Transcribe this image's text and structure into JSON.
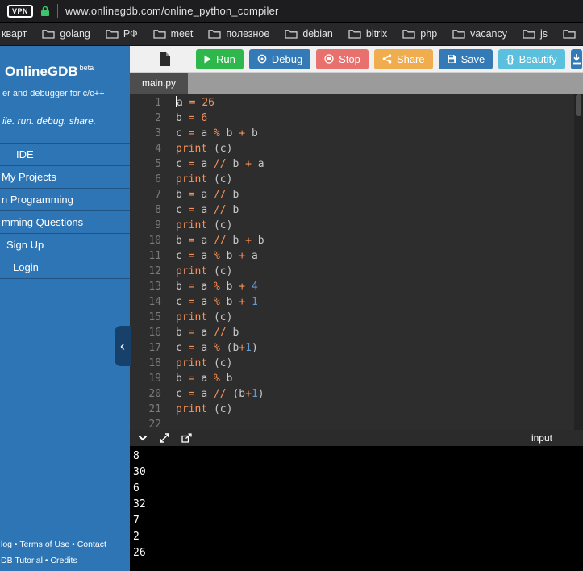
{
  "browser": {
    "vpn_badge": "VPN",
    "url": "www.onlinegdb.com/online_python_compiler",
    "bookmarks": [
      "кварт",
      "golang",
      "РФ",
      "meet",
      "полезное",
      "debian",
      "bitrix",
      "php",
      "vacancy",
      "js"
    ]
  },
  "sidebar": {
    "brand": "OnlineGDB",
    "beta": "beta",
    "tagline1": "er and debugger for c/c++",
    "tagline2": "ile. run. debug. share.",
    "menu": [
      "IDE",
      "My Projects",
      "n Programming",
      "mming Questions",
      "Sign Up",
      "Login"
    ],
    "footer1": "log • Terms of Use • Contact",
    "footer2": "DB Tutorial • Credits"
  },
  "toolbar": {
    "run": "Run",
    "debug": "Debug",
    "stop": "Stop",
    "share": "Share",
    "save": "Save",
    "beautify_icon": "{}",
    "beautify": "Beautify"
  },
  "tabs": [
    {
      "label": "main.py",
      "active": true
    }
  ],
  "editor": {
    "language": "python",
    "line_count": 22,
    "lines": [
      [
        [
          "a ",
          "p"
        ],
        [
          "= ",
          "o"
        ],
        [
          "26",
          "o"
        ]
      ],
      [
        [
          "b ",
          "p"
        ],
        [
          "= ",
          "o"
        ],
        [
          "6",
          "o"
        ]
      ],
      [
        [
          "c ",
          "p"
        ],
        [
          "= ",
          "o"
        ],
        [
          "a ",
          "p"
        ],
        [
          "% ",
          "o"
        ],
        [
          "b ",
          "p"
        ],
        [
          "+ ",
          "o"
        ],
        [
          "b",
          "p"
        ]
      ],
      [
        [
          "print",
          "o"
        ],
        [
          " (c)",
          "p"
        ]
      ],
      [
        [
          "c ",
          "p"
        ],
        [
          "= ",
          "o"
        ],
        [
          "a ",
          "p"
        ],
        [
          "// ",
          "o"
        ],
        [
          "b ",
          "p"
        ],
        [
          "+ ",
          "o"
        ],
        [
          "a",
          "p"
        ]
      ],
      [
        [
          "print",
          "o"
        ],
        [
          " (c)",
          "p"
        ]
      ],
      [
        [
          "b ",
          "p"
        ],
        [
          "= ",
          "o"
        ],
        [
          "a ",
          "p"
        ],
        [
          "// ",
          "o"
        ],
        [
          "b",
          "p"
        ]
      ],
      [
        [
          "c ",
          "p"
        ],
        [
          "= ",
          "o"
        ],
        [
          "a ",
          "p"
        ],
        [
          "// ",
          "o"
        ],
        [
          "b",
          "p"
        ]
      ],
      [
        [
          "print",
          "o"
        ],
        [
          " (c)",
          "p"
        ]
      ],
      [
        [
          "b ",
          "p"
        ],
        [
          "= ",
          "o"
        ],
        [
          "a ",
          "p"
        ],
        [
          "// ",
          "o"
        ],
        [
          "b ",
          "p"
        ],
        [
          "+ ",
          "o"
        ],
        [
          "b",
          "p"
        ]
      ],
      [
        [
          "c ",
          "p"
        ],
        [
          "= ",
          "o"
        ],
        [
          "a ",
          "p"
        ],
        [
          "% ",
          "o"
        ],
        [
          "b ",
          "p"
        ],
        [
          "+ ",
          "o"
        ],
        [
          "a",
          "p"
        ]
      ],
      [
        [
          "print",
          "o"
        ],
        [
          " (c)",
          "p"
        ]
      ],
      [
        [
          "b ",
          "p"
        ],
        [
          "= ",
          "o"
        ],
        [
          "a ",
          "p"
        ],
        [
          "% ",
          "o"
        ],
        [
          "b ",
          "p"
        ],
        [
          "+ ",
          "o"
        ],
        [
          "4",
          "n"
        ]
      ],
      [
        [
          "c ",
          "p"
        ],
        [
          "= ",
          "o"
        ],
        [
          "a ",
          "p"
        ],
        [
          "% ",
          "o"
        ],
        [
          "b ",
          "p"
        ],
        [
          "+ ",
          "o"
        ],
        [
          "1",
          "n"
        ]
      ],
      [
        [
          "print",
          "o"
        ],
        [
          " (c)",
          "p"
        ]
      ],
      [
        [
          "b ",
          "p"
        ],
        [
          "= ",
          "o"
        ],
        [
          "a ",
          "p"
        ],
        [
          "// ",
          "o"
        ],
        [
          "b",
          "p"
        ]
      ],
      [
        [
          "c ",
          "p"
        ],
        [
          "= ",
          "o"
        ],
        [
          "a ",
          "p"
        ],
        [
          "% ",
          "o"
        ],
        [
          "(b",
          "p"
        ],
        [
          "+",
          "o"
        ],
        [
          "1",
          "n"
        ],
        [
          ")",
          "p"
        ]
      ],
      [
        [
          "print",
          "o"
        ],
        [
          " (c)",
          "p"
        ]
      ],
      [
        [
          "b ",
          "p"
        ],
        [
          "= ",
          "o"
        ],
        [
          "a ",
          "p"
        ],
        [
          "% ",
          "o"
        ],
        [
          "b",
          "p"
        ]
      ],
      [
        [
          "c ",
          "p"
        ],
        [
          "= ",
          "o"
        ],
        [
          "a ",
          "p"
        ],
        [
          "// ",
          "o"
        ],
        [
          "(b",
          "p"
        ],
        [
          "+",
          "o"
        ],
        [
          "1",
          "n"
        ],
        [
          ")",
          "p"
        ]
      ],
      [
        [
          "print",
          "o"
        ],
        [
          " (c)",
          "p"
        ]
      ],
      []
    ]
  },
  "console": {
    "input_label": "input",
    "output": [
      "8",
      "30",
      "6",
      "32",
      "7",
      "2",
      "26"
    ]
  },
  "colors": {
    "sidebar_blue": "#2e75b5",
    "run_green": "#2eb84b",
    "primary_blue": "#337ab7",
    "stop_red": "#e8716d",
    "share_orange": "#f0ad4e",
    "beautify_blue": "#5bc0de",
    "editor_bg": "#2d2d2d",
    "code_plain": "#c8c8c8",
    "code_orange": "#f99157",
    "code_number_blue": "#6699cc",
    "console_bg": "#000000"
  }
}
